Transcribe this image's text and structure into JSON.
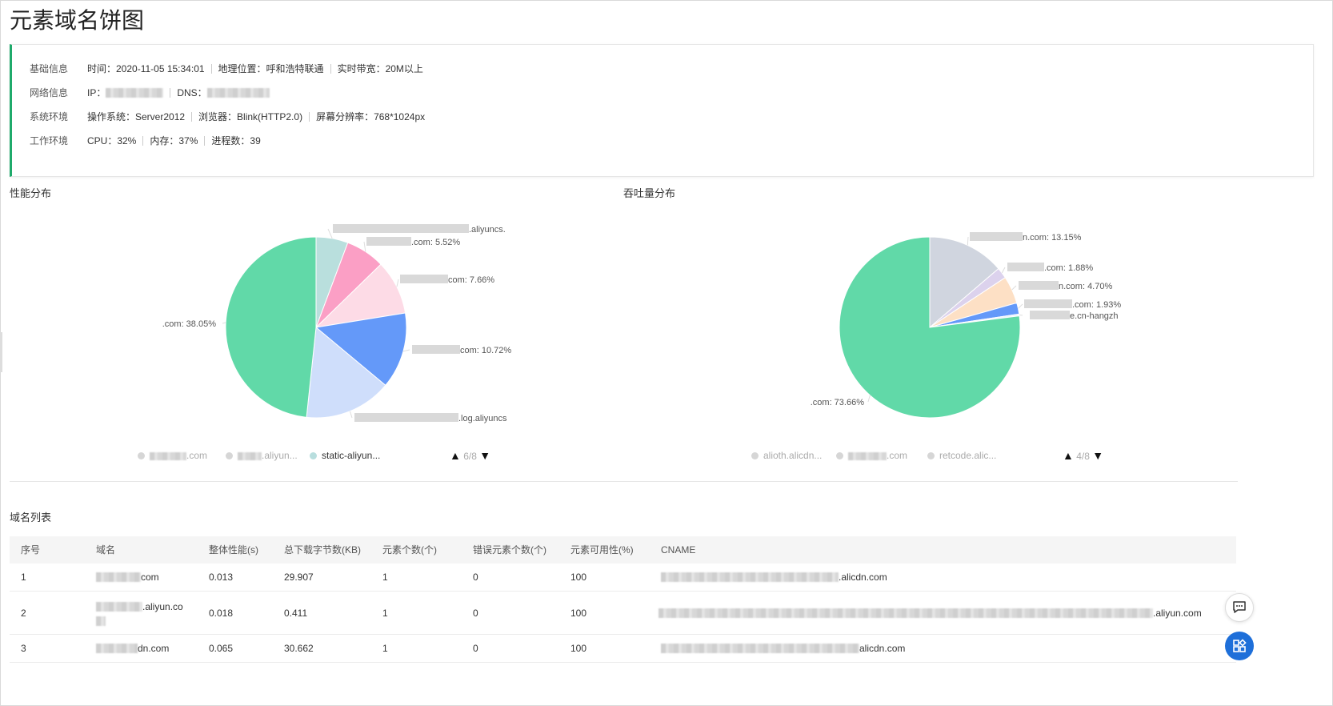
{
  "page": {
    "title": "元素域名饼图"
  },
  "info": {
    "rows": [
      {
        "label": "基础信息",
        "segments": [
          "时间：2020-11-05 15:34:01",
          "地理位置：呼和浩特联通",
          "实时带宽：20M以上"
        ]
      },
      {
        "label": "网络信息",
        "ip_label": "IP：",
        "dns_label": "DNS："
      },
      {
        "label": "系统环境",
        "segments": [
          "操作系统：Server2012",
          "浏览器：Blink(HTTP2.0)",
          "屏幕分辨率：768*1024px"
        ]
      },
      {
        "label": "工作环境",
        "segments": [
          "CPU：32%",
          "内存：37%",
          "进程数：39"
        ]
      }
    ]
  },
  "performance": {
    "title": "性能分布",
    "legend": [
      ".com",
      ".aliyun...",
      "static-aliyun..."
    ],
    "page": "6/8"
  },
  "throughput": {
    "title": "吞吐量分布",
    "legend": [
      "alioth.alicdn...",
      ".com",
      "retcode.alic..."
    ],
    "page": "4/8"
  },
  "chart_data": [
    {
      "type": "pie",
      "title": "性能分布",
      "slices": [
        {
          "label": ".aliyuncs.",
          "value": 4.5,
          "color": "#b9dfdd"
        },
        {
          "label": ".com: 5.52%",
          "value": 5.52,
          "color": "#fb9fc5"
        },
        {
          "label": "com: 7.66%",
          "value": 7.66,
          "color": "#fddbe6"
        },
        {
          "label": "com: 10.72%",
          "value": 10.72,
          "color": "#6499f9"
        },
        {
          "label": ".log.aliyuncs",
          "value": 12.3,
          "color": "#cfdefb"
        },
        {
          "label": ".com: 38.05%",
          "value": 38.05,
          "color": "#61d9a8"
        }
      ]
    },
    {
      "type": "pie",
      "title": "吞吐量分布",
      "slices": [
        {
          "label": "n.com: 13.15%",
          "value": 13.15,
          "color": "#d0d5df"
        },
        {
          "label": ".com: 1.88%",
          "value": 1.88,
          "color": "#dcd2ed"
        },
        {
          "label": "n.com: 4.70%",
          "value": 4.7,
          "color": "#fde0c5"
        },
        {
          "label": ".com: 1.93%",
          "value": 1.93,
          "color": "#6499f9"
        },
        {
          "label": "e.cn-hangzh",
          "value": 0.3,
          "color": "#eaf2fd"
        },
        {
          "label": ".com: 73.66%",
          "value": 73.66,
          "color": "#61d9a8"
        }
      ]
    }
  ],
  "domains": {
    "title": "域名列表",
    "columns": [
      "序号",
      "域名",
      "整体性能(s)",
      "总下载字节数(KB)",
      "元素个数(个)",
      "错误元素个数(个)",
      "元素可用性(%)",
      "CNAME"
    ],
    "rows": [
      {
        "no": "1",
        "domain": "com",
        "perf": "0.013",
        "bytes": "29.907",
        "count": "1",
        "errors": "0",
        "avail": "100",
        "cname": ".alicdn.com"
      },
      {
        "no": "2",
        "domain": ".aliyun.co",
        "perf": "0.018",
        "bytes": "0.411",
        "count": "1",
        "errors": "0",
        "avail": "100",
        "cname": ".aliyun.com"
      },
      {
        "no": "3",
        "domain": "dn.com",
        "perf": "0.065",
        "bytes": "30.662",
        "count": "1",
        "errors": "0",
        "avail": "100",
        "cname": "alicdn.com"
      }
    ]
  },
  "icons": {
    "chat": "chat-bubble-icon",
    "apps": "grid-apps-icon"
  },
  "colors": {
    "accent": "#1faa6b",
    "primary": "#1e6fd9"
  }
}
